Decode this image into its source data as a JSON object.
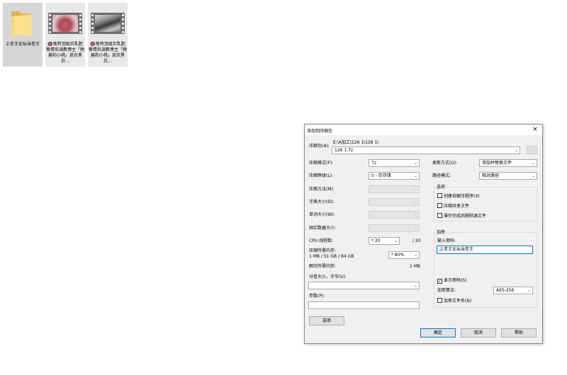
{
  "desktop": {
    "files": [
      {
        "name": "上老王论坛当老王",
        "type": "folder",
        "icon": "folder-icon",
        "selected": true
      },
      {
        "name": "🔞推特顶级巨乳肥臀情侣调教博主「晚酱和小桃」皮衣黑白…",
        "type": "video",
        "icon": "video-thumbnail-icon"
      },
      {
        "name": "🔞推特顶级巨乳肥臀情侣调教博主「晚酱和小桃」皮衣黑白…",
        "type": "video",
        "icon": "video-thumbnail-icon"
      }
    ]
  },
  "dialog": {
    "title": "添加到压缩包",
    "close_glyph": "×",
    "archive_label": "压缩包(A):",
    "archive_path": "E:\\A加工\\126 1\\126 1\\",
    "archive_name": "126 1.7z",
    "browse_label": "...",
    "left": {
      "format_label": "压缩格式(F):",
      "format_value": "7z",
      "level_label": "压缩等级(L):",
      "level_value": "0 - 仅存储",
      "method_label": "压缩方法(M):",
      "dict_label": "字典大小(D):",
      "word_label": "单词大小(W):",
      "solid_label": "固实数据大小:",
      "cpu_label": "CPU 线程数:",
      "cpu_value": "* 20",
      "cpu_total": "/ 20",
      "mem_label": "压缩所需内存:",
      "mem_detail": "1 MB / 51 GB / 64 GB",
      "mem_value": "* 80%",
      "decomp_label": "解压所需内存:",
      "decomp_value": "1 MB",
      "split_label": "分卷大小，字节(V):",
      "params_label": "参数(P):",
      "options_button": "选项"
    },
    "right": {
      "update_label": "更新方式(U):",
      "update_value": "添加并替换文件",
      "path_label": "路径模式:",
      "path_value": "相对路径",
      "options_group": "选项",
      "opt_sfx": "创建自解压程序(X)",
      "opt_shared": "压缩共享文件",
      "opt_delete": "操作完成后删除源文件",
      "encrypt_group": "加密",
      "password_label": "输入密码:",
      "password_value": "上老王论坛当老王",
      "show_password": "显示密码(S)",
      "method_label": "加密算法:",
      "method_value": "AES-256",
      "encrypt_names": "加密文件名(N)"
    },
    "buttons": {
      "ok": "确定",
      "cancel": "取消",
      "help": "帮助"
    },
    "check_glyph": "✓",
    "combo_arrow": "⌄"
  }
}
